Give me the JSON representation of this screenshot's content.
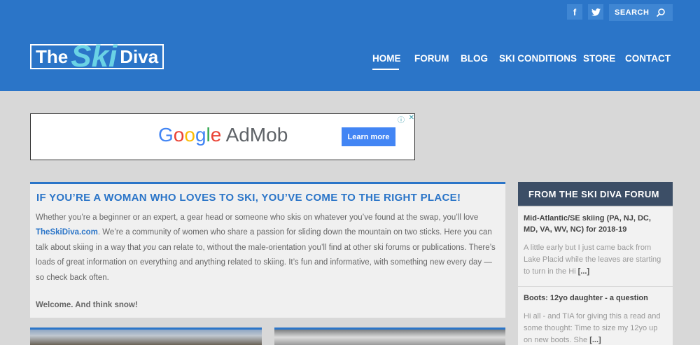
{
  "header": {
    "social": {
      "facebook": "f",
      "twitter": "t"
    },
    "search_label": "SEARCH",
    "logo": {
      "left": "The",
      "middle": "Ski",
      "right": "Diva"
    },
    "nav": [
      "HOME",
      "FORUM",
      "BLOG",
      "SKI CONDITIONS",
      "STORE",
      "CONTACT"
    ],
    "active_nav": "HOME"
  },
  "ad": {
    "brand_google": [
      "G",
      "o",
      "o",
      "g",
      "l",
      "e"
    ],
    "brand_product": "AdMob",
    "cta": "Learn more",
    "info": "ⓘ",
    "close": "✕"
  },
  "main": {
    "title": "IF YOU’RE A WOMAN WHO LOVES TO SKI, YOU’VE COME TO THE RIGHT PLACE!",
    "p1_a": "Whether you’re a beginner or an expert, a gear head or someone who skis on whatever you’ve found at the swap, you’ll love ",
    "p1_link": "TheSkiDiva.com",
    "p1_b": ". We’re a community of women who share a passion for sliding down the mountain on two sticks. Here you can talk about skiing in a way that ",
    "p1_em": "you",
    "p1_c": " can relate to, without the male-orientation you’ll find at other ski forums or publications. There’s loads of great information on everything and anything related to skiing. It’s fun and informative, with something new every day — so check back often.",
    "closing": "Welcome. And think snow!"
  },
  "sidebar": {
    "heading": "FROM THE SKI DIVA FORUM",
    "items": [
      {
        "title": "Mid-Atlantic/SE skiing (PA, NJ, DC, MD, VA, WV, NC) for 2018-19",
        "text": "A little early but I just came back from Lake Placid while the leaves are starting to turn in the Hi",
        "more": "[...]"
      },
      {
        "title": "Boots: 12yo daughter - a question",
        "text": "Hi all - and TIA for giving this a read and some thought: Time to size my 12yo up on new boots. She",
        "more": "[...]"
      }
    ]
  },
  "colors": {
    "header_bg": "#2b75c8",
    "page_bg": "#d8d8d8",
    "accent": "#2b75c8",
    "sidebar_head": "#3c4e66",
    "logo_ski": "#6ad2e5"
  }
}
